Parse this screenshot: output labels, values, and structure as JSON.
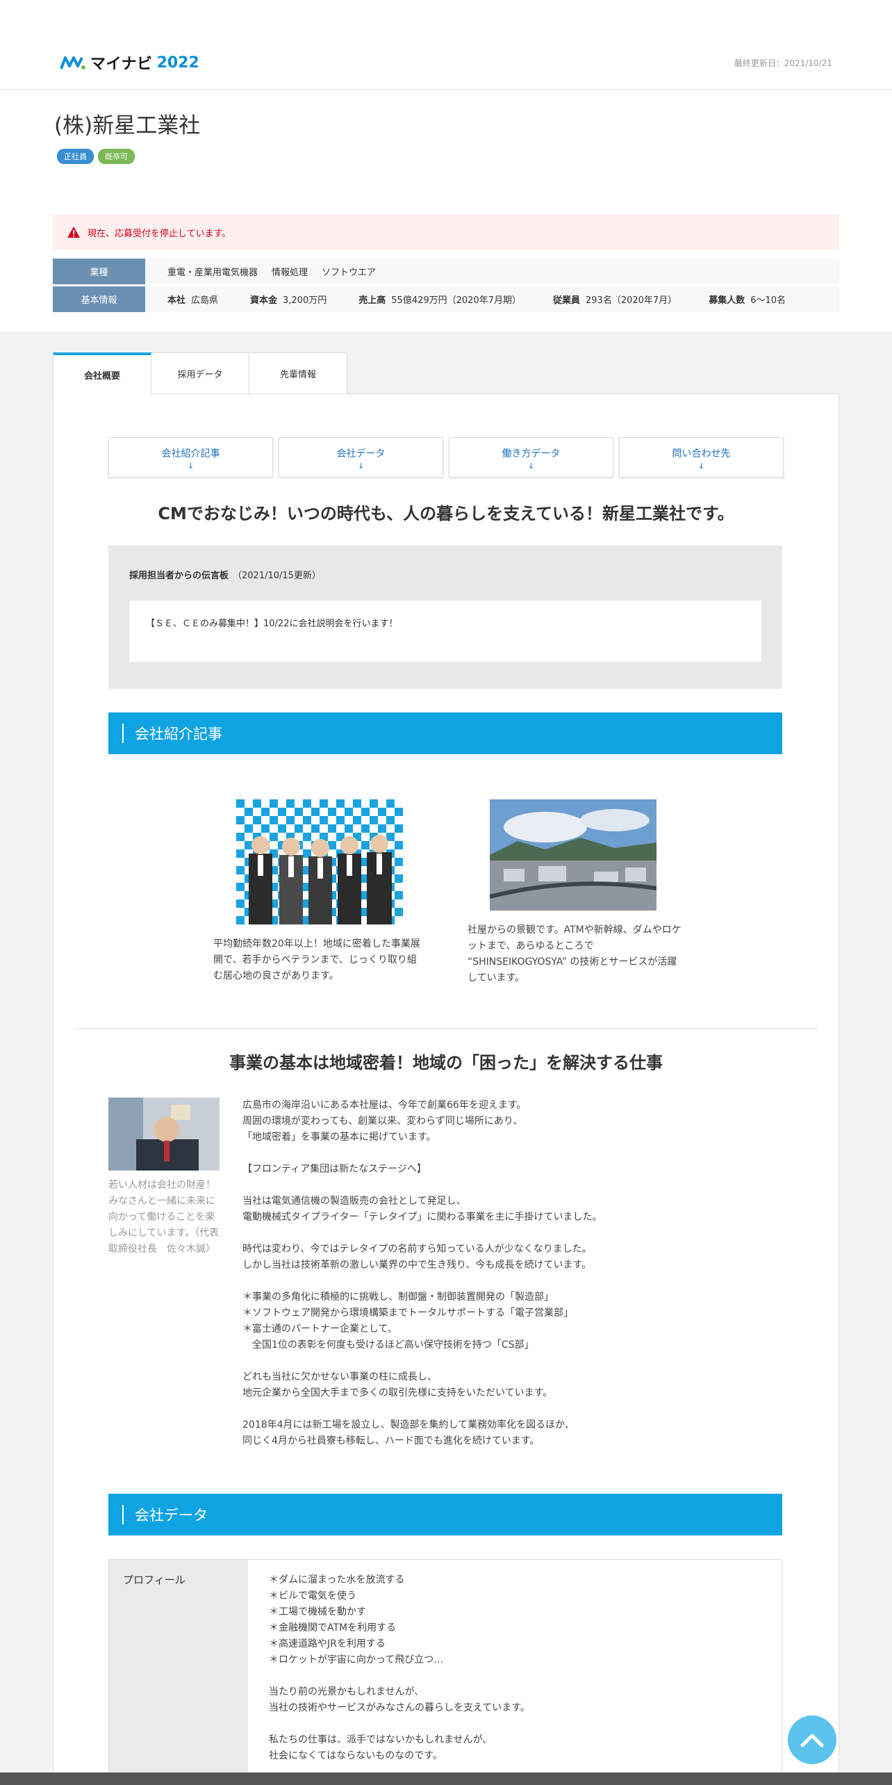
{
  "header": {
    "logo_text": "マイナビ",
    "logo_year": "2022",
    "updated": "最終更新日：2021/10/21"
  },
  "company": {
    "name": "(株)新星工業社",
    "badges": [
      "正社員",
      "既卒可"
    ],
    "alert": "現在、応募受付を停止しています。",
    "industry_label": "業種",
    "industries": [
      "重電・産業用電気機器",
      "情報処理",
      "ソフトウエア"
    ],
    "basic_label": "基本情報",
    "basic": {
      "hq_label": "本社",
      "hq": "広島県",
      "capital_label": "資本金",
      "capital": "3,200万円",
      "sales_label": "売上高",
      "sales": "55億429万円（2020年7月期）",
      "employees_label": "従業員",
      "employees": "293名（2020年7月）",
      "hiring_label": "募集人数",
      "hiring": "6～10名"
    }
  },
  "tabs": [
    "会社概要",
    "採用データ",
    "先輩情報"
  ],
  "anchors": [
    {
      "label": "会社紹介記事",
      "arrow": "↓"
    },
    {
      "label": "会社データ",
      "arrow": "↓"
    },
    {
      "label": "働き方データ",
      "arrow": "↓"
    },
    {
      "label": "問い合わせ先",
      "arrow": "↓"
    }
  ],
  "catch": "CMでおなじみ！いつの時代も、人の暮らしを支えている！新星工業社です。",
  "board": {
    "title": "採用担当者からの伝言板",
    "date": "（2021/10/15更新）",
    "message": "【ＳＥ、ＣＥのみ募集中！】10/22に会社説明会を行います！"
  },
  "sections": {
    "intro": "会社紹介記事",
    "data": "会社データ"
  },
  "articles": [
    {
      "caption": "平均勤続年数20年以上！地域に密着した事業展開で、若手からベテランまで、じっくり取り組む居心地の良さがあります。"
    },
    {
      "caption": "社屋からの景観です。ATMや新幹線、ダムやロケットまで、あらゆるところで “SHINSEIKOGYOSYA” の技術とサービスが活躍しています。"
    }
  ],
  "feature": {
    "title": "事業の基本は地域密着！地域の「困った」を解決する仕事",
    "ceo_caption": "若い人材は会社の財産！みなさんと一緒に未来に向かって働けることを楽しみにしています。（代表取締役社長　佐々木誠）",
    "body": "広島市の海岸沿いにある本社屋は、今年で創業66年を迎えます。\n周囲の環境が変わっても、創業以来、変わらず同じ場所にあり、\n「地域密着」を事業の基本に掲げています。\n\n【フロンティア集団は新たなステージへ】\n\n当社は電気通信機の製造販売の会社として発足し、\n電動機械式タイプライター「テレタイプ」に関わる事業を主に手掛けていました。\n\n時代は変わり、今ではテレタイプの名前すら知っている人が少なくなりました。\nしかし当社は技術革新の激しい業界の中で生き残り、今も成長を続けています。\n\n＊事業の多角化に積極的に挑戦し、制御盤・制御装置開発の「製造部」\n＊ソフトウェア開発から環境構築までトータルサポートする「電子営業部」\n＊富士通のパートナー企業として、\n　全国1位の表彰を何度も受けるほど高い保守技術を持つ「CS部」\n\nどれも当社に欠かせない事業の柱に成長し、\n地元企業から全国大手まで多くの取引先様に支持をいただいています。\n\n2018年4月には新工場を設立し、製造部を集約して業務効率化を図るほか、\n同じく4月から社員寮も移転し、ハード面でも進化を続けています。"
  },
  "profile": {
    "label": "プロフィール",
    "body": "＊ダムに溜まった水を放流する\n＊ビルで電気を使う\n＊工場で機械を動かす\n＊金融機関でATMを利用する\n＊高速道路やJRを利用する\n＊ロケットが宇宙に向かって飛び立つ…\n\n当たり前の光景かもしれませんが、\n当社の技術やサービスがみなさんの暮らしを支えています。\n\n私たちの仕事は、派手ではないかもしれませんが、\n社会になくてはならないものなのです。"
  },
  "colors": {
    "accent": "#10a3e2",
    "info_head": "#6a8fb1",
    "alert": "#d0021b"
  }
}
